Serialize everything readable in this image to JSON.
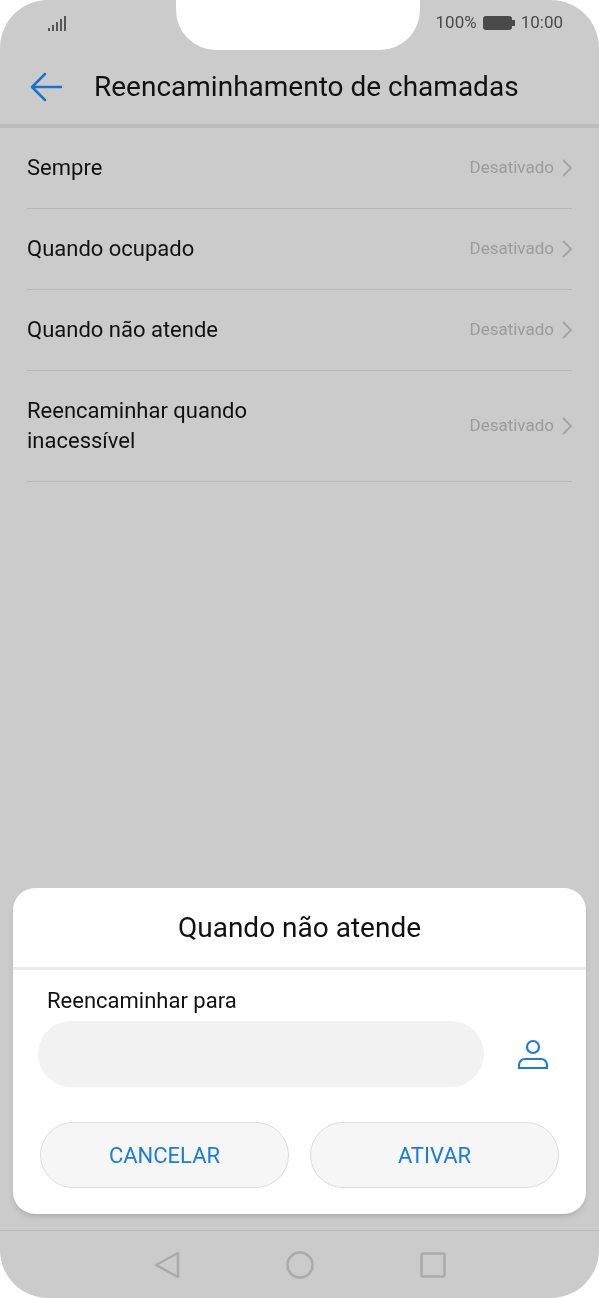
{
  "status_bar": {
    "battery": "100%",
    "time": "10:00"
  },
  "header": {
    "title": "Reencaminhamento de chamadas"
  },
  "rows": [
    {
      "label": "Sempre",
      "value": "Desativado"
    },
    {
      "label": "Quando ocupado",
      "value": "Desativado"
    },
    {
      "label": "Quando não atende",
      "value": "Desativado"
    },
    {
      "label": "Reencaminhar quando inacessível",
      "value": "Desativado"
    }
  ],
  "dialog": {
    "title": "Quando não atende",
    "field_label": "Reencaminhar para",
    "buttons": [
      "CANCELAR",
      "ATIVAR"
    ]
  }
}
